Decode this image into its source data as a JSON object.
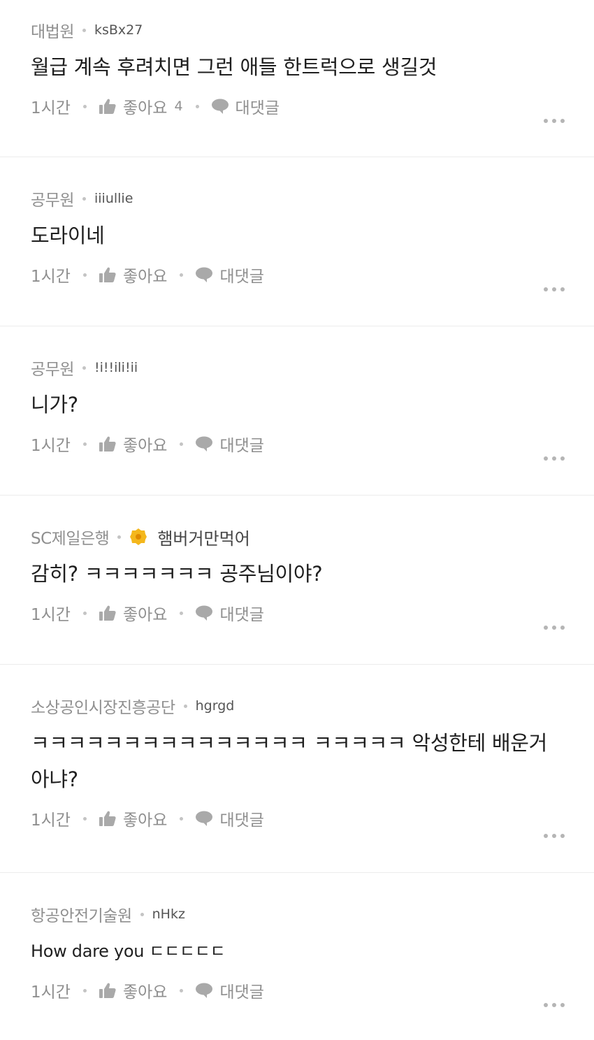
{
  "comments": [
    {
      "company": "대법원",
      "nickname": "ksBx27",
      "text": "월급 계속 후려치면 그런 애들 한트럭으로 생길것",
      "time": "1시간",
      "like_label": "좋아요",
      "like_count": "4",
      "reply_label": "대댓글"
    },
    {
      "company": "공무원",
      "nickname": "iiiullie",
      "text": "도라이네",
      "time": "1시간",
      "like_label": "좋아요",
      "reply_label": "대댓글"
    },
    {
      "company": "공무원",
      "nickname": "!i!!ili!ii",
      "text": "니가?",
      "time": "1시간",
      "like_label": "좋아요",
      "reply_label": "대댓글"
    },
    {
      "company": "SC제일은행",
      "nickname": "햄버거만먹어",
      "badge_icon": "gold-badge-icon",
      "text": "감히? ㅋㅋㅋㅋㅋㅋㅋ 공주님이야?",
      "time": "1시간",
      "like_label": "좋아요",
      "reply_label": "대댓글"
    },
    {
      "company": "소상공인시장진흥공단",
      "nickname": "hgrgd",
      "text": "ㅋㅋㅋㅋㅋㅋㅋㅋㅋㅋㅋㅋㅋㅋㅋ ㅋㅋㅋㅋㅋ 악성한테 배운거아냐?",
      "time": "1시간",
      "like_label": "좋아요",
      "reply_label": "대댓글"
    },
    {
      "company": "항공안전기술원",
      "nickname": "nHkz",
      "text": "How dare you ㄷㄷㄷㄷㄷ",
      "time": "1시간",
      "like_label": "좋아요",
      "reply_label": "대댓글"
    }
  ],
  "icons": {
    "like": "thumbs-up-icon",
    "reply": "speech-bubble-icon",
    "more": "more-dots-icon"
  },
  "colors": {
    "meta_text": "#8f8f8f",
    "body_text": "#1f1f1f",
    "divider": "#ececec",
    "badge": "#f4b71c"
  }
}
